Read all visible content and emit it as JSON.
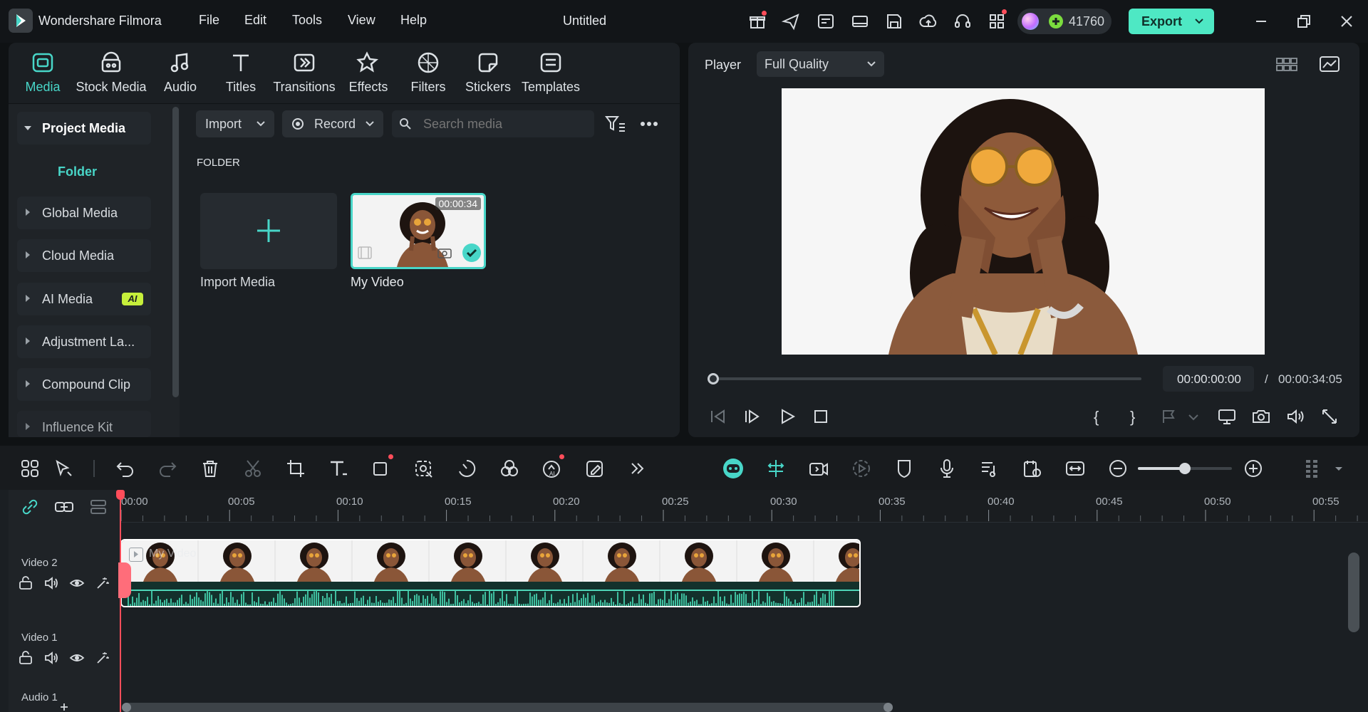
{
  "app": {
    "name": "Wondershare Filmora",
    "doc_title": "Untitled",
    "credits": "41760",
    "export_label": "Export"
  },
  "menu": [
    "File",
    "Edit",
    "Tools",
    "View",
    "Help"
  ],
  "tabs": [
    {
      "label": "Media",
      "icon": "media-icon"
    },
    {
      "label": "Stock Media",
      "icon": "stock-media-icon"
    },
    {
      "label": "Audio",
      "icon": "audio-note-icon"
    },
    {
      "label": "Titles",
      "icon": "titles-icon"
    },
    {
      "label": "Transitions",
      "icon": "transitions-icon"
    },
    {
      "label": "Effects",
      "icon": "effects-icon"
    },
    {
      "label": "Filters",
      "icon": "filters-icon"
    },
    {
      "label": "Stickers",
      "icon": "stickers-icon"
    },
    {
      "label": "Templates",
      "icon": "templates-icon"
    }
  ],
  "sidebar": {
    "project_media": "Project Media",
    "folder": "Folder",
    "items": [
      "Global Media",
      "Cloud Media",
      "AI Media",
      "Adjustment La...",
      "Compound Clip",
      "Influence Kit"
    ],
    "ai_badge": "AI"
  },
  "media_toolbar": {
    "import": "Import",
    "record": "Record",
    "search_placeholder": "Search media"
  },
  "media": {
    "section": "FOLDER",
    "import_label": "Import Media",
    "clip_name": "My Video",
    "clip_duration": "00:00:34"
  },
  "player": {
    "label": "Player",
    "quality": "Full Quality",
    "current_time": "00:00:00:00",
    "separator": "/",
    "total_time": "00:00:34:05",
    "progress": 0
  },
  "timeline": {
    "ruler": [
      "00:00",
      "00:05",
      "00:10",
      "00:15",
      "00:20",
      "00:25",
      "00:30",
      "00:35",
      "00:40",
      "00:45",
      "00:50",
      "00:55"
    ],
    "tracks": [
      "Video 2",
      "Video 1",
      "Audio 1"
    ],
    "clip_label": "My Video",
    "zoom_level": 0.5
  },
  "colors": {
    "accent": "#48d6c8",
    "export_bg": "#4ee8c4",
    "playhead": "#ff4d5a"
  }
}
